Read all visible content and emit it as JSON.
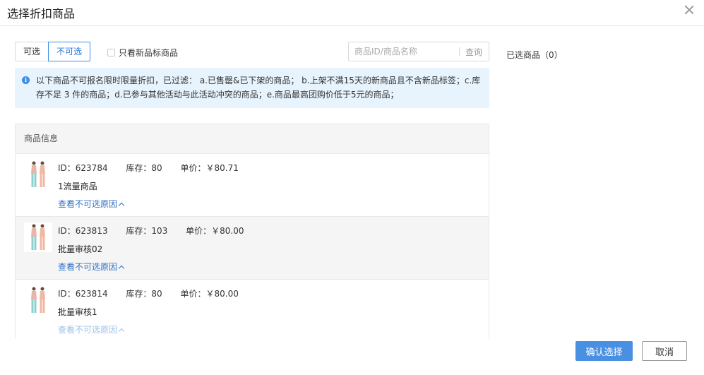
{
  "dialog": {
    "title": "选择折扣商品",
    "close_icon": "close-icon"
  },
  "tabs": [
    {
      "label": "可选",
      "active": false
    },
    {
      "label": "不可选",
      "active": true
    }
  ],
  "filter": {
    "new_only_label": "只看新品标商品",
    "checked": false
  },
  "search": {
    "placeholder": "商品ID/商品名称",
    "value": "",
    "button_label": "查询"
  },
  "notice": {
    "icon": "info-icon",
    "text": "以下商品不可报名限时限量折扣，已过滤： a.已售罄&已下架的商品； b.上架不满15天的新商品且不含新品标签；c.库存不足 3 件的商品；d.已参与其他活动与此活动冲突的商品；e.商品最高团购价低于5元的商品；"
  },
  "table": {
    "header": "商品信息",
    "rows": [
      {
        "id": "ID：623784",
        "stock": "库存：80",
        "price": "单价：￥80.71",
        "name": "1流量商品",
        "reason": "查看不可选原因"
      },
      {
        "id": "ID：623813",
        "stock": "库存：103",
        "price": "单价：￥80.00",
        "name": "批量审核02",
        "reason": "查看不可选原因"
      },
      {
        "id": "ID：623814",
        "stock": "库存：80",
        "price": "单价：￥80.00",
        "name": "批量审核1",
        "reason": "查看不可选原因"
      }
    ]
  },
  "selected": {
    "label": "已选商品（0）"
  },
  "footer": {
    "confirm_label": "确认选择",
    "cancel_label": "取消"
  },
  "colors": {
    "accent": "#4a90e2",
    "link": "#2f6fc4",
    "notice_bg": "#e8f4fd"
  }
}
